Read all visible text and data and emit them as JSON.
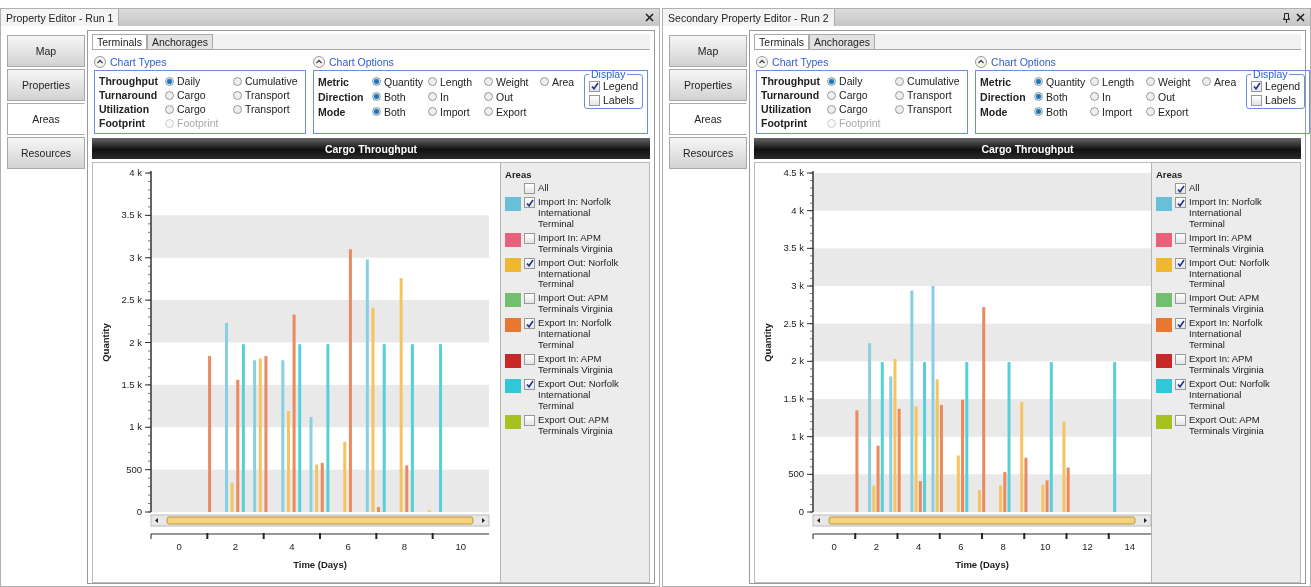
{
  "panels": [
    {
      "title": "Property Editor - Run 1",
      "title_icons": [
        {
          "kind": "close"
        }
      ],
      "nav": [
        {
          "label": "Map",
          "selected": false
        },
        {
          "label": "Properties",
          "selected": false
        },
        {
          "label": "Areas",
          "selected": true
        },
        {
          "label": "Resources",
          "selected": false
        }
      ],
      "tabs": [
        {
          "label": "Terminals",
          "selected": true
        },
        {
          "label": "Anchorages",
          "selected": false
        }
      ],
      "chart_types": {
        "title": "Chart Types",
        "expanded": true,
        "rows": [
          {
            "label": "Throughput",
            "options": [
              {
                "label": "Daily",
                "selected": true,
                "disabled": false
              },
              {
                "label": "Cumulative",
                "selected": false,
                "disabled": false
              }
            ]
          },
          {
            "label": "Turnaround",
            "options": [
              {
                "label": "Cargo",
                "selected": false,
                "disabled": false
              },
              {
                "label": "Transport",
                "selected": false,
                "disabled": false
              }
            ]
          },
          {
            "label": "Utilization",
            "options": [
              {
                "label": "Cargo",
                "selected": false,
                "disabled": false
              },
              {
                "label": "Transport",
                "selected": false,
                "disabled": false
              }
            ]
          },
          {
            "label": "Footprint",
            "options": [
              {
                "label": "Footprint",
                "selected": false,
                "disabled": true
              }
            ]
          }
        ]
      },
      "chart_options": {
        "title": "Chart Options",
        "expanded": true,
        "rows": [
          {
            "label": "Metric",
            "options": [
              {
                "label": "Quantity",
                "selected": true,
                "disabled": false
              },
              {
                "label": "Length",
                "selected": false,
                "disabled": false
              },
              {
                "label": "Weight",
                "selected": false,
                "disabled": false
              },
              {
                "label": "Area",
                "selected": false,
                "disabled": false
              }
            ]
          },
          {
            "label": "Direction",
            "options": [
              {
                "label": "Both",
                "selected": true,
                "disabled": false
              },
              {
                "label": "In",
                "selected": false,
                "disabled": false
              },
              {
                "label": "Out",
                "selected": false,
                "disabled": false
              }
            ]
          },
          {
            "label": "Mode",
            "options": [
              {
                "label": "Both",
                "selected": true,
                "disabled": false
              },
              {
                "label": "Import",
                "selected": false,
                "disabled": false
              },
              {
                "label": "Export",
                "selected": false,
                "disabled": false
              }
            ]
          }
        ],
        "display": {
          "title": "Display",
          "items": [
            {
              "label": "Legend",
              "checked": true
            },
            {
              "label": "Labels",
              "checked": false
            }
          ]
        }
      },
      "chart": {
        "title": "Cargo Throughput",
        "chart_data": {
          "type": "bar",
          "xlabel": "Time (Days)",
          "ylabel": "Quantity",
          "x": [
            1.08,
            1.68,
            1.88,
            2.08,
            2.28,
            2.68,
            2.88,
            3.08,
            3.68,
            3.88,
            4.08,
            4.28,
            4.68,
            4.88,
            5.08,
            5.28,
            5.88,
            6.08,
            6.68,
            6.88,
            7.08,
            7.28,
            7.88,
            8.08,
            8.28,
            8.88,
            9.28
          ],
          "series": [
            {
              "color": "#86d0e2",
              "values": [
                null,
                2230,
                null,
                null,
                null,
                1790,
                null,
                null,
                1790,
                null,
                null,
                null,
                1120,
                null,
                null,
                null,
                null,
                null,
                2980,
                null,
                null,
                null,
                null,
                null,
                null,
                null,
                null
              ]
            },
            {
              "color": "#f5c45e",
              "values": [
                null,
                null,
                340,
                null,
                null,
                null,
                1810,
                null,
                null,
                1190,
                null,
                null,
                null,
                560,
                null,
                null,
                830,
                null,
                null,
                2410,
                null,
                null,
                2760,
                null,
                null,
                20,
                null
              ]
            },
            {
              "color": "#ea8a5e",
              "values": [
                1840,
                null,
                null,
                1560,
                null,
                null,
                null,
                1840,
                null,
                null,
                2330,
                null,
                null,
                null,
                580,
                null,
                null,
                3100,
                null,
                null,
                60,
                null,
                null,
                550,
                null,
                null,
                null
              ]
            },
            {
              "color": "#55d0d8",
              "values": [
                null,
                null,
                null,
                null,
                1980,
                null,
                null,
                null,
                null,
                null,
                null,
                1980,
                null,
                null,
                null,
                1980,
                null,
                null,
                null,
                null,
                null,
                1980,
                null,
                null,
                1980,
                null,
                1980
              ]
            }
          ],
          "xlim": [
            -1,
            11
          ],
          "ylim": [
            0,
            4000
          ],
          "xticks": [
            0,
            2,
            4,
            6,
            8,
            10
          ],
          "yticks": [
            {
              "value": 0,
              "label": "0"
            },
            {
              "value": 500,
              "label": "500"
            },
            {
              "value": 1000,
              "label": "1 k"
            },
            {
              "value": 1500,
              "label": "1.5 k"
            },
            {
              "value": 2000,
              "label": "2 k"
            },
            {
              "value": 2500,
              "label": "2.5 k"
            },
            {
              "value": 3000,
              "label": "3 k"
            },
            {
              "value": 3500,
              "label": "3.5 k"
            },
            {
              "value": 4000,
              "label": "4 k"
            }
          ]
        }
      },
      "legend": {
        "title": "Areas",
        "all": {
          "label": "All",
          "checked": false
        },
        "items": [
          {
            "label": "Import In: Norfolk International Terminal",
            "color": "#68c0d8",
            "checked": true
          },
          {
            "label": "Import In: APM Terminals Virginia",
            "color": "#e8607a",
            "checked": false
          },
          {
            "label": "Import Out: Norfolk International Terminal",
            "color": "#f0b830",
            "checked": true
          },
          {
            "label": "Import Out: APM Terminals Virginia",
            "color": "#70c070",
            "checked": false
          },
          {
            "label": "Export In: Norfolk International Terminal",
            "color": "#e87830",
            "checked": true
          },
          {
            "label": "Export In: APM Terminals Virginia",
            "color": "#c82828",
            "checked": false
          },
          {
            "label": "Export Out: Norfolk International Terminal",
            "color": "#30c8d8",
            "checked": true
          },
          {
            "label": "Export Out: APM Terminals Virginia",
            "color": "#a8c020",
            "checked": false
          }
        ]
      }
    },
    {
      "title": "Secondary Property Editor - Run 2",
      "title_icons": [
        {
          "kind": "pin"
        },
        {
          "kind": "close"
        }
      ],
      "nav": [
        {
          "label": "Map",
          "selected": false
        },
        {
          "label": "Properties",
          "selected": false
        },
        {
          "label": "Areas",
          "selected": true
        },
        {
          "label": "Resources",
          "selected": false
        }
      ],
      "tabs": [
        {
          "label": "Terminals",
          "selected": true
        },
        {
          "label": "Anchorages",
          "selected": false
        }
      ],
      "chart_types": {
        "title": "Chart Types",
        "expanded": true,
        "rows": [
          {
            "label": "Throughput",
            "options": [
              {
                "label": "Daily",
                "selected": true,
                "disabled": false
              },
              {
                "label": "Cumulative",
                "selected": false,
                "disabled": false
              }
            ]
          },
          {
            "label": "Turnaround",
            "options": [
              {
                "label": "Cargo",
                "selected": false,
                "disabled": false
              },
              {
                "label": "Transport",
                "selected": false,
                "disabled": false
              }
            ]
          },
          {
            "label": "Utilization",
            "options": [
              {
                "label": "Cargo",
                "selected": false,
                "disabled": false
              },
              {
                "label": "Transport",
                "selected": false,
                "disabled": false
              }
            ]
          },
          {
            "label": "Footprint",
            "options": [
              {
                "label": "Footprint",
                "selected": false,
                "disabled": true
              }
            ]
          }
        ]
      },
      "chart_options": {
        "title": "Chart Options",
        "expanded": true,
        "rows": [
          {
            "label": "Metric",
            "options": [
              {
                "label": "Quantity",
                "selected": true,
                "disabled": false
              },
              {
                "label": "Length",
                "selected": false,
                "disabled": false
              },
              {
                "label": "Weight",
                "selected": false,
                "disabled": false
              },
              {
                "label": "Area",
                "selected": false,
                "disabled": false
              }
            ]
          },
          {
            "label": "Direction",
            "options": [
              {
                "label": "Both",
                "selected": true,
                "disabled": false
              },
              {
                "label": "In",
                "selected": false,
                "disabled": false
              },
              {
                "label": "Out",
                "selected": false,
                "disabled": false
              }
            ]
          },
          {
            "label": "Mode",
            "options": [
              {
                "label": "Both",
                "selected": true,
                "disabled": false
              },
              {
                "label": "Import",
                "selected": false,
                "disabled": false
              },
              {
                "label": "Export",
                "selected": false,
                "disabled": false
              }
            ]
          }
        ],
        "display": {
          "title": "Display",
          "items": [
            {
              "label": "Legend",
              "checked": true
            },
            {
              "label": "Labels",
              "checked": false
            }
          ]
        }
      },
      "chart": {
        "title": "Cargo Throughput",
        "chart_data": {
          "type": "bar",
          "xlabel": "Time (Days)",
          "ylabel": "Quantity",
          "x": [
            1.08,
            1.68,
            1.88,
            2.08,
            2.28,
            2.68,
            2.88,
            3.08,
            3.68,
            3.88,
            4.08,
            4.28,
            4.68,
            4.88,
            5.08,
            5.88,
            6.08,
            6.28,
            6.88,
            7.08,
            7.88,
            8.08,
            8.28,
            8.88,
            9.08,
            9.88,
            10.08,
            10.28,
            10.88,
            11.08,
            13.28
          ],
          "series": [
            {
              "color": "#86d0e2",
              "values": [
                null,
                2240,
                null,
                null,
                null,
                1800,
                null,
                null,
                2940,
                null,
                null,
                null,
                3000,
                null,
                null,
                null,
                null,
                null,
                null,
                null,
                null,
                null,
                null,
                null,
                null,
                null,
                null,
                null,
                null,
                null,
                null
              ]
            },
            {
              "color": "#f5c45e",
              "values": [
                null,
                null,
                350,
                null,
                null,
                null,
                2030,
                null,
                null,
                1400,
                null,
                null,
                null,
                1760,
                null,
                750,
                null,
                null,
                290,
                null,
                350,
                null,
                null,
                1460,
                null,
                360,
                null,
                null,
                1200,
                null,
                null
              ]
            },
            {
              "color": "#ea8a5e",
              "values": [
                1350,
                null,
                null,
                880,
                null,
                null,
                null,
                1370,
                null,
                null,
                410,
                null,
                null,
                null,
                1420,
                null,
                1490,
                null,
                null,
                2720,
                null,
                530,
                null,
                null,
                720,
                null,
                420,
                null,
                null,
                590,
                null
              ]
            },
            {
              "color": "#55d0d8",
              "values": [
                null,
                null,
                null,
                null,
                1990,
                null,
                null,
                null,
                null,
                null,
                null,
                1990,
                null,
                null,
                null,
                null,
                null,
                1990,
                null,
                null,
                null,
                null,
                1990,
                null,
                null,
                null,
                null,
                1990,
                null,
                null,
                1990
              ]
            }
          ],
          "xlim": [
            -1,
            15
          ],
          "ylim": [
            0,
            4500
          ],
          "xticks": [
            0,
            2,
            4,
            6,
            8,
            10,
            12,
            14
          ],
          "yticks": [
            {
              "value": 0,
              "label": "0"
            },
            {
              "value": 500,
              "label": "500"
            },
            {
              "value": 1000,
              "label": "1 k"
            },
            {
              "value": 1500,
              "label": "1.5 k"
            },
            {
              "value": 2000,
              "label": "2 k"
            },
            {
              "value": 2500,
              "label": "2.5 k"
            },
            {
              "value": 3000,
              "label": "3 k"
            },
            {
              "value": 3500,
              "label": "3.5 k"
            },
            {
              "value": 4000,
              "label": "4 k"
            },
            {
              "value": 4500,
              "label": "4.5 k"
            }
          ]
        }
      },
      "legend": {
        "title": "Areas",
        "all": {
          "label": "All",
          "checked": true
        },
        "items": [
          {
            "label": "Import In: Norfolk International Terminal",
            "color": "#68c0d8",
            "checked": true
          },
          {
            "label": "Import In: APM Terminals Virginia",
            "color": "#e8607a",
            "checked": false
          },
          {
            "label": "Import Out: Norfolk International Terminal",
            "color": "#f0b830",
            "checked": true
          },
          {
            "label": "Import Out: APM Terminals Virginia",
            "color": "#70c070",
            "checked": false
          },
          {
            "label": "Export In: Norfolk International Terminal",
            "color": "#e87830",
            "checked": true
          },
          {
            "label": "Export In: APM Terminals Virginia",
            "color": "#c82828",
            "checked": false
          },
          {
            "label": "Export Out: Norfolk International Terminal",
            "color": "#30c8d8",
            "checked": true
          },
          {
            "label": "Export Out: APM Terminals Virginia",
            "color": "#a8c020",
            "checked": false
          }
        ]
      }
    }
  ]
}
